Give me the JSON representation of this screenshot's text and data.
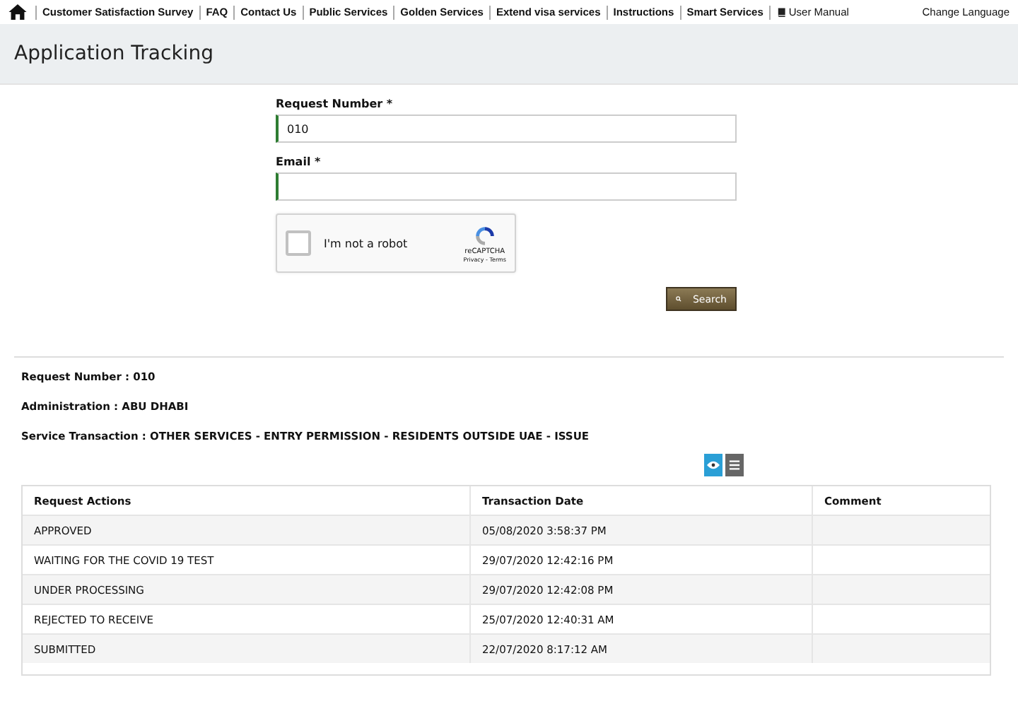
{
  "nav": {
    "links": [
      "Customer Satisfaction Survey",
      "FAQ",
      "Contact Us",
      "Public Services",
      "Golden Services",
      "Extend visa services",
      "Instructions",
      "Smart Services"
    ],
    "manual": "User Manual",
    "language": "Change Language"
  },
  "page_title": "Application Tracking",
  "form": {
    "request_label": "Request Number *",
    "request_value": "010",
    "email_label": "Email *",
    "captcha": {
      "label": "I'm not a robot",
      "checked": false,
      "brand": "reCAPTCHA",
      "links": "Privacy - Terms"
    },
    "search_button": "Search"
  },
  "details": [
    {
      "label": "Request Number :",
      "value": "010"
    },
    {
      "label": "Administration :",
      "value": "ABU DHABI"
    },
    {
      "label": "Service Transaction :",
      "value": "OTHER SERVICES - ENTRY PERMISSION - RESIDENTS OUTSIDE UAE - ISSUE"
    }
  ],
  "view_toggles": [
    {
      "kind": "eye",
      "selected": true
    },
    {
      "kind": "list",
      "selected": false
    }
  ],
  "table": {
    "columns": [
      "Request Actions",
      "Transaction Date",
      "Comment"
    ],
    "rows": [
      [
        "APPROVED",
        "05/08/2020 3:58:37 PM"
      ],
      [
        "WAITING FOR THE COVID 19 TEST",
        "29/07/2020 12:42:16 PM"
      ],
      [
        "UNDER PROCESSING",
        "29/07/2020 12:42:08 PM"
      ],
      [
        "REJECTED TO RECEIVE",
        "25/07/2020 12:40:31 AM"
      ],
      [
        "SUBMITTED",
        "22/07/2020 8:17:12 AM"
      ]
    ]
  }
}
